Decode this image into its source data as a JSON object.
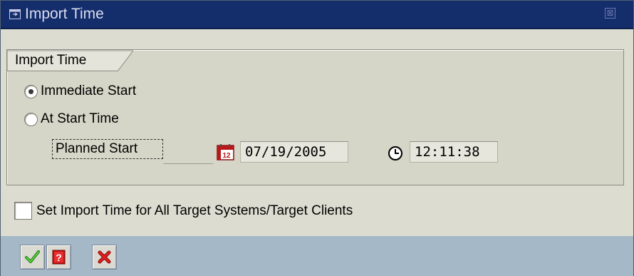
{
  "window": {
    "title": "Import Time",
    "close_symbol": "⊠"
  },
  "group": {
    "title": "Import Time",
    "options": [
      {
        "label": "Immediate Start",
        "selected": true
      },
      {
        "label": "At Start Time",
        "selected": false
      }
    ],
    "planned_start": {
      "label": "Planned Start",
      "date": "07/19/2005",
      "time": "12:11:38"
    }
  },
  "all_targets": {
    "label": "Set Import Time for All Target Systems/Target Clients",
    "checked": false
  },
  "toolbar": {
    "buttons": [
      {
        "icon": "checkmark-icon",
        "color": "#2a9a1a"
      },
      {
        "icon": "help-icon",
        "color": "#c81010"
      },
      {
        "icon": "cancel-icon",
        "color": "#c81010"
      }
    ]
  },
  "colors": {
    "title_bar": "#142d6b",
    "dialog_bg": "#dcdcd0",
    "toolbar_bg": "#a4b8c8"
  }
}
